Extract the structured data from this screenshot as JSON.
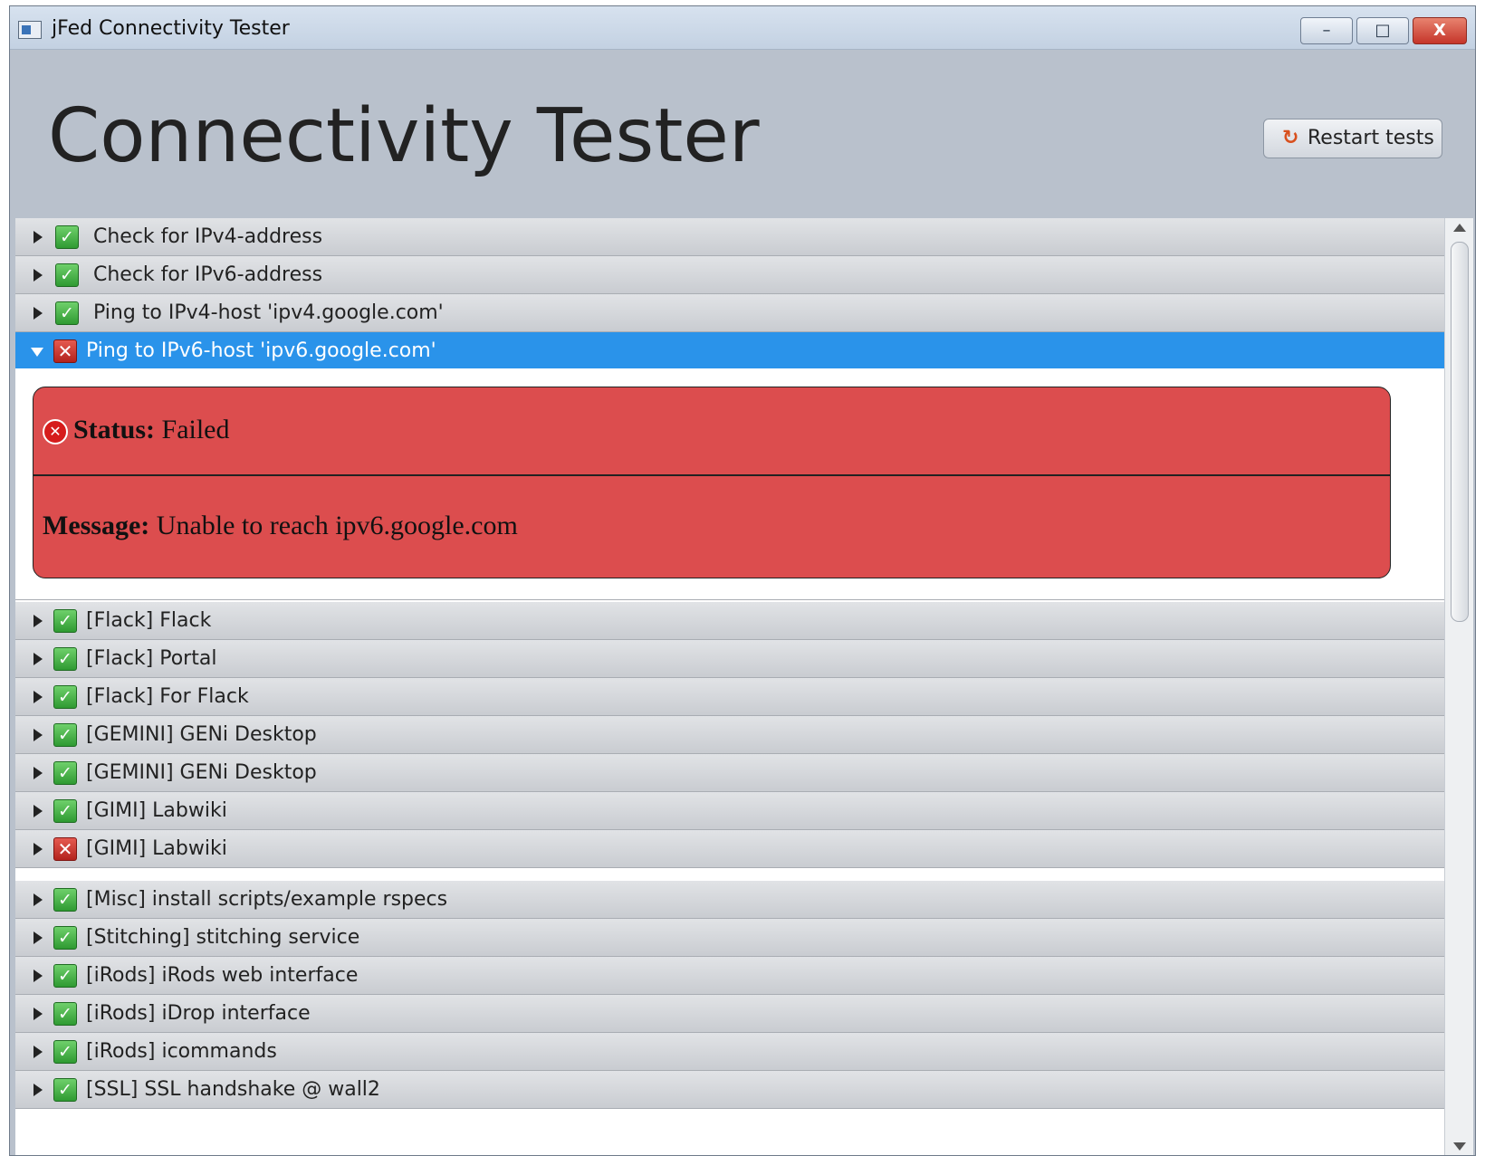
{
  "window": {
    "title": "jFed Connectivity Tester",
    "minimize": "–",
    "maximize": "□",
    "close": "X"
  },
  "header": {
    "title": "Connectivity Tester",
    "restart_label": "Restart tests",
    "restart_icon": "↻"
  },
  "tests": [
    {
      "label": "Check for IPv4-address",
      "status": "passed"
    },
    {
      "label": "Check for IPv6-address",
      "status": "passed"
    },
    {
      "label": "Ping to IPv4-host 'ipv4.google.com'",
      "status": "passed"
    },
    {
      "label": "Ping to IPv6-host 'ipv6.google.com'",
      "status": "failed",
      "expanded": true
    },
    {
      "label": "[Flack] Flack",
      "status": "passed"
    },
    {
      "label": "[Flack] Portal",
      "status": "passed"
    },
    {
      "label": "[Flack] For Flack",
      "status": "passed"
    },
    {
      "label": "[GEMINI] GENi Desktop",
      "status": "passed"
    },
    {
      "label": "[GEMINI] GENi Desktop",
      "status": "passed"
    },
    {
      "label": "[GIMI] Labwiki",
      "status": "passed"
    },
    {
      "label": "[GIMI] Labwiki",
      "status": "failed"
    },
    {
      "label": "[Misc] install scripts/example rspecs",
      "status": "passed"
    },
    {
      "label": "[Stitching] stitching service",
      "status": "passed"
    },
    {
      "label": "[iRods] iRods web interface",
      "status": "passed"
    },
    {
      "label": "[iRods] iDrop interface",
      "status": "passed"
    },
    {
      "label": "[iRods] icommands",
      "status": "passed"
    },
    {
      "label": "[SSL] SSL handshake @ wall2",
      "status": "passed"
    }
  ],
  "detail": {
    "status_label": "Status:",
    "status_value": "Failed",
    "message_label": "Message:",
    "message_value": "Unable to reach ipv6.google.com"
  },
  "icons": {
    "check": "✓",
    "fail": "✕",
    "status_fail": "✕"
  },
  "colors": {
    "selected_row": "#2a93ea",
    "detail_bg": "#dc4d4e",
    "pass": "#2f9a32",
    "fail": "#b3231d"
  }
}
